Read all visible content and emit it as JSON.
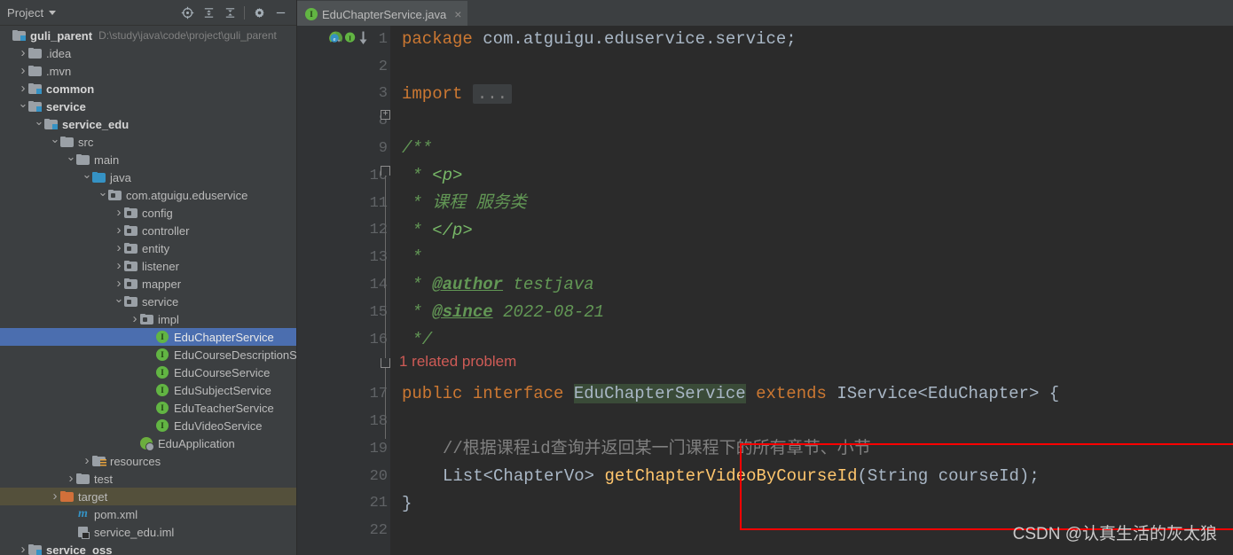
{
  "panel": {
    "title": "Project",
    "tools": [
      {
        "name": "locate-icon",
        "label": "Select Opened File"
      },
      {
        "name": "expand-all-icon",
        "label": "Expand All"
      },
      {
        "name": "collapse-all-icon",
        "label": "Collapse All"
      },
      {
        "name": "gear-icon",
        "label": "Settings"
      },
      {
        "name": "minimize-icon",
        "label": "Hide"
      }
    ],
    "tree": [
      {
        "label": "guli_parent",
        "hint": "D:\\study\\java\\code\\project\\guli_parent",
        "indent": 0,
        "arrow": "none",
        "icon": "folder-module",
        "bold": true,
        "state": "normal"
      },
      {
        "label": ".idea",
        "hint": "",
        "indent": 1,
        "arrow": "right",
        "icon": "folder",
        "bold": false,
        "state": "normal"
      },
      {
        "label": ".mvn",
        "hint": "",
        "indent": 1,
        "arrow": "right",
        "icon": "folder",
        "bold": false,
        "state": "normal"
      },
      {
        "label": "common",
        "hint": "",
        "indent": 1,
        "arrow": "right",
        "icon": "folder-module",
        "bold": true,
        "state": "normal"
      },
      {
        "label": "service",
        "hint": "",
        "indent": 1,
        "arrow": "down",
        "icon": "folder-module",
        "bold": true,
        "state": "normal"
      },
      {
        "label": "service_edu",
        "hint": "",
        "indent": 2,
        "arrow": "down",
        "icon": "folder-module",
        "bold": true,
        "state": "normal"
      },
      {
        "label": "src",
        "hint": "",
        "indent": 3,
        "arrow": "down",
        "icon": "folder",
        "bold": false,
        "state": "normal"
      },
      {
        "label": "main",
        "hint": "",
        "indent": 4,
        "arrow": "down",
        "icon": "folder",
        "bold": false,
        "state": "normal"
      },
      {
        "label": "java",
        "hint": "",
        "indent": 5,
        "arrow": "down",
        "icon": "folder-src",
        "bold": false,
        "state": "normal"
      },
      {
        "label": "com.atguigu.eduservice",
        "hint": "",
        "indent": 6,
        "arrow": "down",
        "icon": "folder-pkg",
        "bold": false,
        "state": "normal"
      },
      {
        "label": "config",
        "hint": "",
        "indent": 7,
        "arrow": "right",
        "icon": "folder-pkg",
        "bold": false,
        "state": "normal"
      },
      {
        "label": "controller",
        "hint": "",
        "indent": 7,
        "arrow": "right",
        "icon": "folder-pkg",
        "bold": false,
        "state": "normal"
      },
      {
        "label": "entity",
        "hint": "",
        "indent": 7,
        "arrow": "right",
        "icon": "folder-pkg",
        "bold": false,
        "state": "normal"
      },
      {
        "label": "listener",
        "hint": "",
        "indent": 7,
        "arrow": "right",
        "icon": "folder-pkg",
        "bold": false,
        "state": "normal"
      },
      {
        "label": "mapper",
        "hint": "",
        "indent": 7,
        "arrow": "right",
        "icon": "folder-pkg",
        "bold": false,
        "state": "normal"
      },
      {
        "label": "service",
        "hint": "",
        "indent": 7,
        "arrow": "down",
        "icon": "folder-pkg",
        "bold": false,
        "state": "normal"
      },
      {
        "label": "impl",
        "hint": "",
        "indent": 8,
        "arrow": "right",
        "icon": "folder-pkg",
        "bold": false,
        "state": "normal"
      },
      {
        "label": "EduChapterService",
        "hint": "",
        "indent": 9,
        "arrow": "none",
        "icon": "interface",
        "bold": false,
        "state": "selected"
      },
      {
        "label": "EduCourseDescriptionService",
        "hint": "",
        "indent": 9,
        "arrow": "none",
        "icon": "interface",
        "bold": false,
        "state": "normal"
      },
      {
        "label": "EduCourseService",
        "hint": "",
        "indent": 9,
        "arrow": "none",
        "icon": "interface",
        "bold": false,
        "state": "normal"
      },
      {
        "label": "EduSubjectService",
        "hint": "",
        "indent": 9,
        "arrow": "none",
        "icon": "interface",
        "bold": false,
        "state": "normal"
      },
      {
        "label": "EduTeacherService",
        "hint": "",
        "indent": 9,
        "arrow": "none",
        "icon": "interface",
        "bold": false,
        "state": "normal"
      },
      {
        "label": "EduVideoService",
        "hint": "",
        "indent": 9,
        "arrow": "none",
        "icon": "interface",
        "bold": false,
        "state": "normal"
      },
      {
        "label": "EduApplication",
        "hint": "",
        "indent": 8,
        "arrow": "none",
        "icon": "spring-app",
        "bold": false,
        "state": "normal"
      },
      {
        "label": "resources",
        "hint": "",
        "indent": 5,
        "arrow": "right",
        "icon": "folder-res",
        "bold": false,
        "state": "normal"
      },
      {
        "label": "test",
        "hint": "",
        "indent": 4,
        "arrow": "right",
        "icon": "folder",
        "bold": false,
        "state": "normal"
      },
      {
        "label": "target",
        "hint": "",
        "indent": 3,
        "arrow": "right",
        "icon": "folder-target",
        "bold": false,
        "state": "highlighted"
      },
      {
        "label": "pom.xml",
        "hint": "",
        "indent": 4,
        "arrow": "none",
        "icon": "maven",
        "bold": false,
        "state": "normal"
      },
      {
        "label": "service_edu.iml",
        "hint": "",
        "indent": 4,
        "arrow": "none",
        "icon": "iml",
        "bold": false,
        "state": "normal"
      },
      {
        "label": "service_oss",
        "hint": "",
        "indent": 1,
        "arrow": "right",
        "icon": "folder-module",
        "bold": true,
        "state": "normal"
      }
    ]
  },
  "editor": {
    "tab": {
      "label": "EduChapterService.java",
      "icon": "interface-icon",
      "close": "×"
    },
    "line_numbers": [
      "1",
      "2",
      "3",
      "8",
      "9",
      "10",
      "11",
      "12",
      "13",
      "14",
      "15",
      "16",
      "17",
      "18",
      "19",
      "20",
      "21",
      "22"
    ],
    "inlay_hint": "1 related problem",
    "gutter_icons": [
      {
        "name": "spring-bean-icon",
        "line": "17"
      },
      {
        "name": "implemented-by-icon",
        "line": "17"
      }
    ],
    "lines": {
      "l1_kw": "package",
      "l1_rest": " com.atguigu.eduservice.service;",
      "l3_kw": "import",
      "l3_fold": "...",
      "l9": "/**",
      "l10_star": " * ",
      "l10_html": "<p>",
      "l11_star": " * ",
      "l11_text": "课程 服务类",
      "l12_star": " * ",
      "l12_html": "</p>",
      "l13": " *",
      "l14_star": " * ",
      "l14_tag": "@author",
      "l14_text": " testjava",
      "l15_star": " * ",
      "l15_tag": "@since",
      "l15_text": " 2022-08-21",
      "l16": " */",
      "l17_kw1": "public ",
      "l17_kw2": "interface ",
      "l17_cls": "EduChapterService",
      "l17_kw3": " extends ",
      "l17_rest": "IService<EduChapter> {",
      "l19_comment": "//根据课程id查询并返回某一门课程下的所有章节、小节",
      "l20_type": "List<ChapterVo> ",
      "l20_method": "getChapterVideoByCourseId",
      "l20_params": "(String courseId);",
      "l21": "}"
    }
  },
  "annotation": {
    "box_color": "#FF0000"
  },
  "watermark": {
    "text": "CSDN @认真生活的灰太狼"
  },
  "colors": {
    "editor_bg": "#2B2B2B",
    "panel_bg": "#3C3F41",
    "gutter_bg": "#313335",
    "selection_blue": "#4B6EAF",
    "keyword_orange": "#CC7832",
    "javadoc_green": "#629755",
    "method_yellow": "#FFC66D",
    "error_red": "#CF5B56",
    "text_default": "#A9B7C6"
  }
}
